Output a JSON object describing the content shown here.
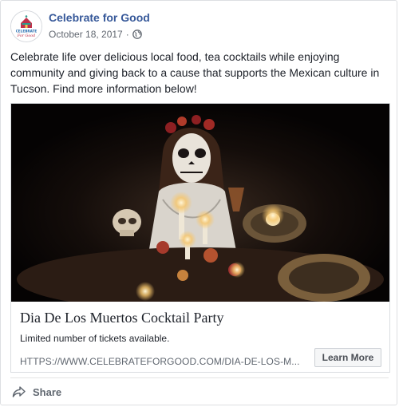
{
  "post": {
    "page_name": "Celebrate for Good",
    "date": "October 18, 2017",
    "separator": "·",
    "privacy_icon": "globe-icon",
    "text": "Celebrate life over delicious local food, tea cocktails while enjoying community and giving back to a cause that supports the Mexican culture in Tucson. Find more information below!"
  },
  "avatar": {
    "logo_icon": "celebrate-for-good-logo",
    "logo_text_top": "CELEBRATE",
    "logo_text_bottom": "For Good"
  },
  "link": {
    "title": "Dia De Los Muertos Cocktail Party",
    "description": "Limited number of tickets available.",
    "url": "HTTPS://WWW.CELEBRATEFORGOOD.COM/DIA-DE-LOS-M...",
    "cta": "Learn More",
    "image_subject": "sugar-skull-candlelit-table-photo"
  },
  "actions": {
    "share_label": "Share",
    "share_icon": "share-arrow-icon"
  },
  "colors": {
    "page_name": "#365899",
    "meta": "#616770",
    "border": "#dddfe2",
    "button_bg": "#f5f6f7"
  }
}
